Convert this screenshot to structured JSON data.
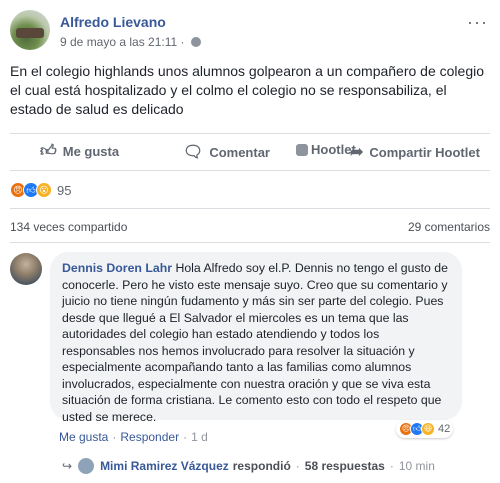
{
  "post": {
    "author": "Alfredo Lievano",
    "date": "9 de mayo a las 21:11",
    "text": "En el colegio highlands unos alumnos golpearon a un compañero de colegio el cual está hospitalizado y el colmo el colegio no se responsabiliza, el estado de salud es delicado",
    "more": "···"
  },
  "actions": {
    "like": "Me gusta",
    "comment": "Comentar",
    "hootlet": "Hootlet",
    "share": "Compartir Hootlet"
  },
  "reactions": {
    "count": "95"
  },
  "stats": {
    "shares": "134 veces compartido",
    "comments": "29 comentarios"
  },
  "comment": {
    "author": "Dennis Doren Lahr",
    "text": "Hola Alfredo soy el.P. Dennis no tengo el gusto de conocerle. Pero he visto este mensaje suyo. Creo que su comentario y juicio no tiene ningún fudamento y más sin ser parte del colegio. Pues desde que llegué a El Salvador el miercoles es un tema que las autoridades del colegio han estado atendiendo y todos los responsables nos hemos involucrado para resolver la situación y especialmente acompañando tanto a las familias como alumnos involucrados, especialmente con nuestra oración y que se viva esta situación de forma cristiana. Le comento esto con todo el respeto que usted se merece.",
    "reaction_count": "42",
    "like_label": "Me gusta",
    "reply_label": "Responder",
    "time": "1 d"
  },
  "reply": {
    "name": "Mimi Ramirez Vázquez",
    "verb": "respondió",
    "count": "58 respuestas",
    "time": "10 min"
  },
  "colors": {
    "link": "#385898",
    "meta": "#616770",
    "bubble": "#f2f3f5"
  }
}
